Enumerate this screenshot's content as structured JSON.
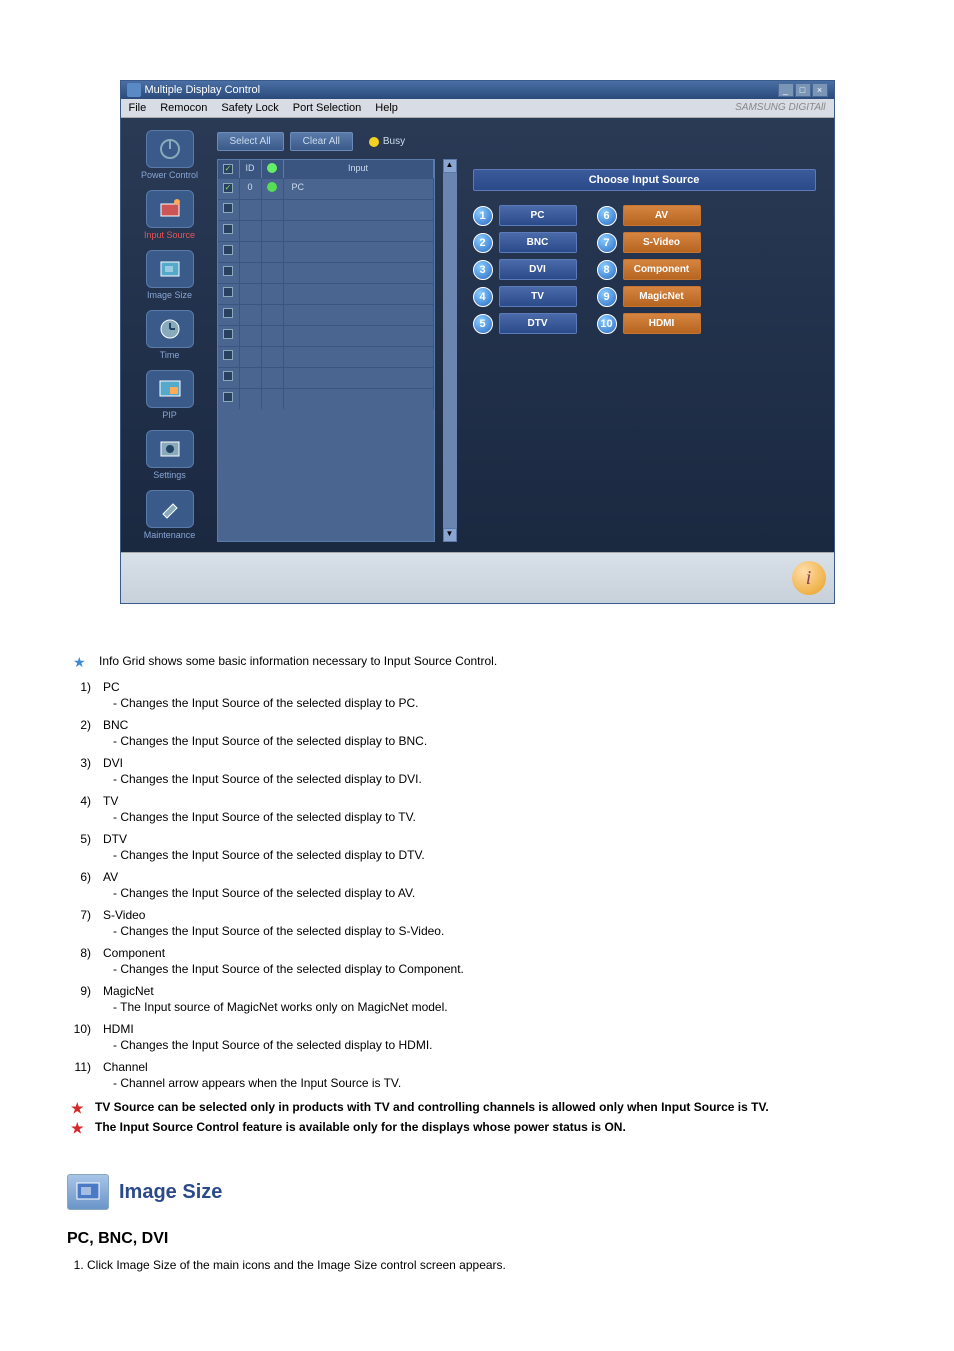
{
  "window": {
    "title": "Multiple Display Control",
    "menu": [
      "File",
      "Remocon",
      "Safety Lock",
      "Port Selection",
      "Help"
    ],
    "brand": "SAMSUNG DIGITAll"
  },
  "sidebar": [
    {
      "label": "Power Control",
      "name": "power-control"
    },
    {
      "label": "Input Source",
      "name": "input-source",
      "selected": true
    },
    {
      "label": "Image Size",
      "name": "image-size"
    },
    {
      "label": "Time",
      "name": "time"
    },
    {
      "label": "PIP",
      "name": "pip"
    },
    {
      "label": "Settings",
      "name": "settings"
    },
    {
      "label": "Maintenance",
      "name": "maintenance"
    }
  ],
  "toolbar": {
    "selectAll": "Select All",
    "clearAll": "Clear All",
    "busy": "Busy"
  },
  "grid": {
    "headers": {
      "chk": "",
      "id": "ID",
      "status": "",
      "input": "Input"
    },
    "rows": [
      {
        "checked": true,
        "id": "0",
        "status": "on",
        "input": "PC"
      },
      {
        "checked": false,
        "id": "",
        "status": "",
        "input": ""
      },
      {
        "checked": false,
        "id": "",
        "status": "",
        "input": ""
      },
      {
        "checked": false,
        "id": "",
        "status": "",
        "input": ""
      },
      {
        "checked": false,
        "id": "",
        "status": "",
        "input": ""
      },
      {
        "checked": false,
        "id": "",
        "status": "",
        "input": ""
      },
      {
        "checked": false,
        "id": "",
        "status": "",
        "input": ""
      },
      {
        "checked": false,
        "id": "",
        "status": "",
        "input": ""
      },
      {
        "checked": false,
        "id": "",
        "status": "",
        "input": ""
      },
      {
        "checked": false,
        "id": "",
        "status": "",
        "input": ""
      },
      {
        "checked": false,
        "id": "",
        "status": "",
        "input": ""
      }
    ]
  },
  "panel": {
    "title": "Choose Input Source",
    "leftCol": [
      {
        "num": "1",
        "label": "PC"
      },
      {
        "num": "2",
        "label": "BNC"
      },
      {
        "num": "3",
        "label": "DVI"
      },
      {
        "num": "4",
        "label": "TV"
      },
      {
        "num": "5",
        "label": "DTV"
      }
    ],
    "rightCol": [
      {
        "num": "6",
        "label": "AV"
      },
      {
        "num": "7",
        "label": "S-Video"
      },
      {
        "num": "8",
        "label": "Component"
      },
      {
        "num": "9",
        "label": "MagicNet"
      },
      {
        "num": "10",
        "label": "HDMI"
      }
    ]
  },
  "doc": {
    "intro": "Info Grid shows some basic information necessary to Input Source Control.",
    "items": [
      {
        "n": "1)",
        "t": "PC",
        "d": "- Changes the Input Source of the selected display to PC."
      },
      {
        "n": "2)",
        "t": "BNC",
        "d": "- Changes the Input Source of the selected display to BNC."
      },
      {
        "n": "3)",
        "t": "DVI",
        "d": "- Changes the Input Source of the selected display to DVI."
      },
      {
        "n": "4)",
        "t": "TV",
        "d": "- Changes the Input Source of the selected display to TV."
      },
      {
        "n": "5)",
        "t": "DTV",
        "d": "- Changes the Input Source of the selected display to DTV."
      },
      {
        "n": "6)",
        "t": "AV",
        "d": "- Changes the Input Source of the selected display to AV."
      },
      {
        "n": "7)",
        "t": "S-Video",
        "d": "- Changes the Input Source of the selected display to S-Video."
      },
      {
        "n": "8)",
        "t": "Component",
        "d": "- Changes the Input Source of the selected display to Component."
      },
      {
        "n": "9)",
        "t": "MagicNet",
        "d": "- The Input source of MagicNet works only on MagicNet model."
      },
      {
        "n": "10)",
        "t": "HDMI",
        "d": "- Changes the Input Source of the selected display to HDMI."
      },
      {
        "n": "11)",
        "t": "Channel",
        "d": "- Channel arrow appears when the Input Source is TV."
      }
    ],
    "note1": "TV Source can be selected only in products with TV and controlling channels is allowed only when Input Source is TV.",
    "note2": "The Input Source Control feature is available only for the displays whose power status is ON.",
    "sectionTitle": "Image Size",
    "subTitle": "PC, BNC, DVI",
    "step1": "Click Image Size of the main icons and the Image Size control screen appears."
  }
}
